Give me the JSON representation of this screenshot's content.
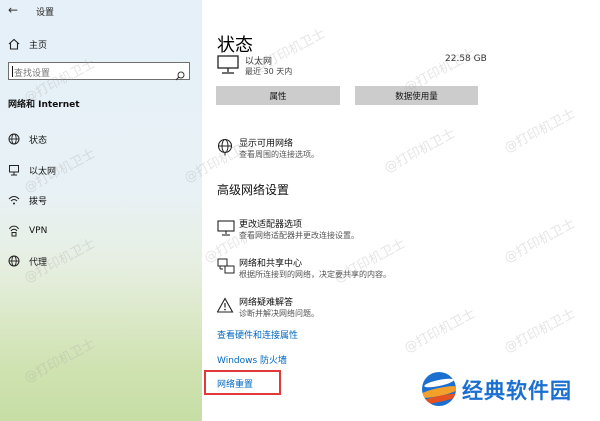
{
  "window": {
    "title": "设置"
  },
  "sidebar": {
    "home_label": "主页",
    "search_placeholder": "查找设置",
    "section_title": "网络和 Internet",
    "items": [
      {
        "label": "状态",
        "icon": "globe-icon"
      },
      {
        "label": "以太网",
        "icon": "ethernet-icon"
      },
      {
        "label": "拨号",
        "icon": "dialup-icon"
      },
      {
        "label": "VPN",
        "icon": "vpn-icon"
      },
      {
        "label": "代理",
        "icon": "proxy-globe-icon"
      }
    ]
  },
  "main": {
    "title": "状态",
    "ethernet": {
      "name": "以太网",
      "period": "最近 30 天内",
      "usage": "22.58 GB"
    },
    "buttons": {
      "properties": "属性",
      "data_usage": "数据使用量"
    },
    "show_networks": {
      "title": "显示可用网络",
      "desc": "查看周围的连接选项。"
    },
    "advanced_title": "高级网络设置",
    "advanced_items": [
      {
        "title": "更改适配器选项",
        "desc": "查看网络适配器并更改连接设置。",
        "icon": "monitor-icon"
      },
      {
        "title": "网络和共享中心",
        "desc": "根据所连接到的网络，决定要共享的内容。",
        "icon": "network-share-icon"
      },
      {
        "title": "网络疑难解答",
        "desc": "诊断并解决网络问题。",
        "icon": "warning-icon"
      }
    ],
    "links": {
      "hardware": "查看硬件和连接属性",
      "firewall": "Windows 防火墙",
      "reset": "网络重置"
    }
  },
  "watermark": {
    "text": "@打印机卫士"
  },
  "logo": {
    "text": "经典软件园"
  },
  "colors": {
    "link": "#0067c0",
    "highlight": "#e03a3a",
    "logo_blue": "#1b6fd0"
  }
}
